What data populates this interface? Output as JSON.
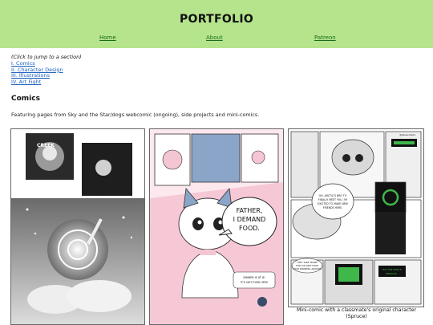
{
  "header": {
    "title": "PORTFOLIO",
    "nav": [
      {
        "label": "Home"
      },
      {
        "label": "About"
      },
      {
        "label": "Patreon"
      }
    ]
  },
  "toc": {
    "hint": "(Click to jump to a section)",
    "items": [
      {
        "label": "I. Comics"
      },
      {
        "label": "II. Character Design"
      },
      {
        "label": "III. Illustrations"
      },
      {
        "label": "IV. Art Fight"
      }
    ]
  },
  "comics": {
    "heading": "Comics",
    "description": "Featuring pages from Sky and the Star/dogs webcomic (ongoing), side projects and mini-comics.",
    "panels": [
      {
        "texts": [
          "CREEK"
        ]
      },
      {
        "texts": [
          "FATHER,",
          "I DEMAND",
          "FOOD.",
          "DINNER IS AT 6!",
          "IT'S NOT EVEN 3PM!"
        ]
      },
      {
        "texts": [
          "@blossomarts",
          "OH, ARCTIC'S BRO TO",
          "FINALLY MEET YOU, I'M",
          "EXCITED TO MAKE NEW",
          "FRIENDS HERE.",
          "THEY TAKE TEAMS",
          "FOR YOU NOT HAVE",
          "FOUR DRAWING AROUND",
          "BUT THE WHOLE",
          "WEBPAGE..."
        ]
      }
    ],
    "caption": "Mini-comic with a classmate's original character (Spruce)"
  },
  "colors": {
    "header_bg": "#b5e48c",
    "nav_link": "#1a6b1a",
    "toc_link": "#1a5fbf",
    "pink_accent": "#f4c5d2",
    "screen_green": "#3fb74a"
  }
}
